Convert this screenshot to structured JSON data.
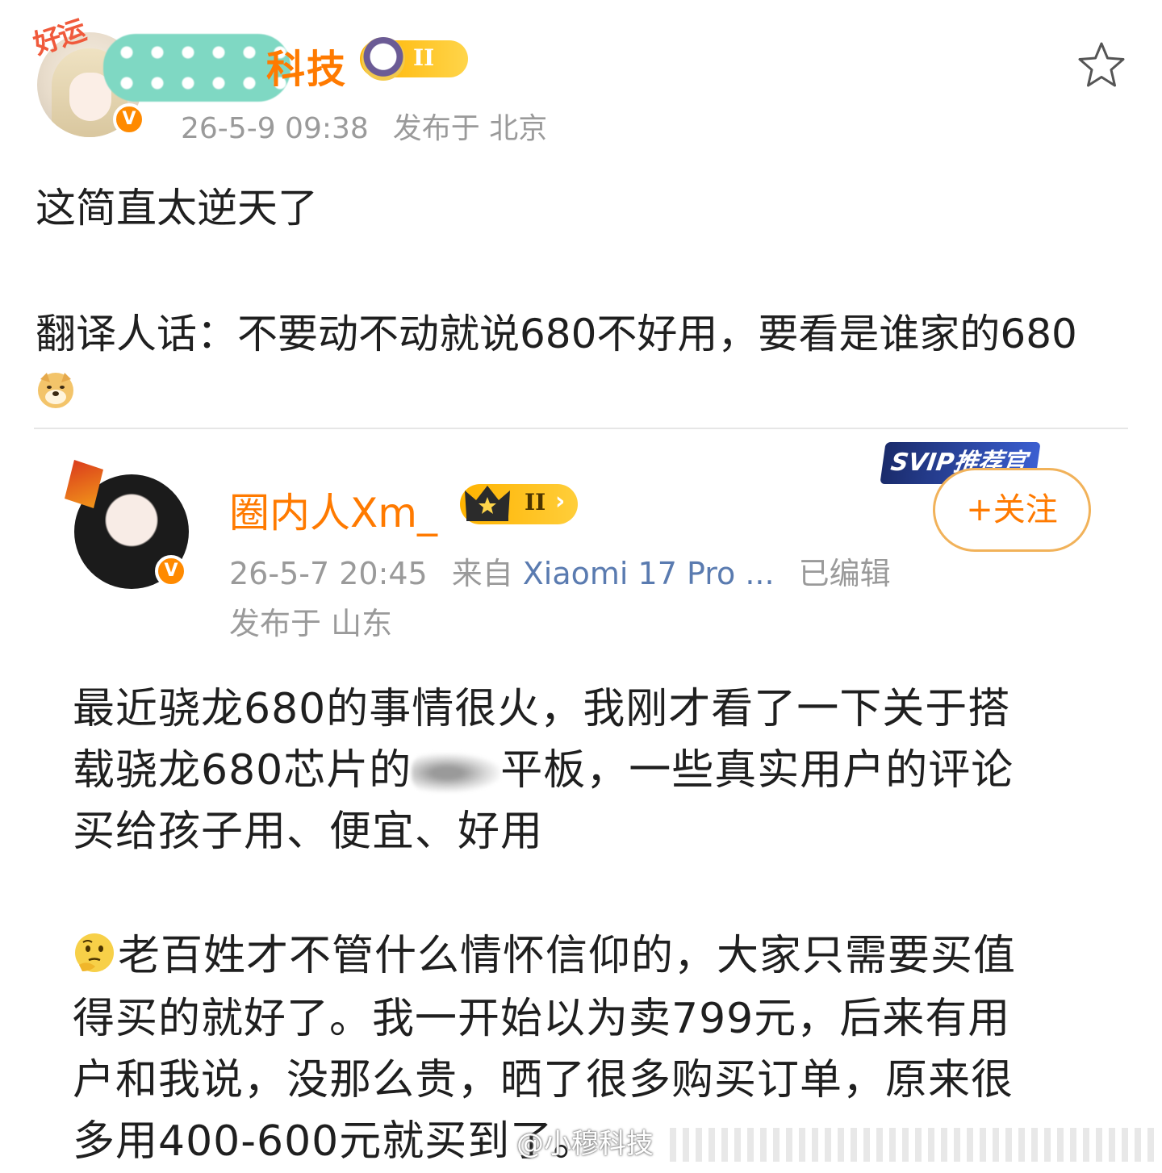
{
  "post": {
    "author_name_visible": "科技",
    "avatar_badge": "好运",
    "level_badge": "II",
    "verified_icon": "v-badge-icon",
    "timestamp": "26-5-9 09:38",
    "location": "发布于 北京",
    "favorite_icon": "star-outline-icon",
    "text_line1": "这简直太逆天了",
    "text_line2": "翻译人话：不要动不动就说680不好用，要看是谁家的680",
    "emoji": "doge-icon"
  },
  "quoted": {
    "author_name": "圈内人Xm_",
    "level_badge": "II",
    "svip_tag": "SVIP推荐官",
    "follow_label": "+关注",
    "timestamp": "26-5-7 20:45",
    "source": "来自",
    "device": "Xiaomi 17 Pro ...",
    "edited": "已编辑",
    "location": "发布于 山东",
    "para1": {
      "line1": "最近骁龙680的事情很火，我刚才看了一下关于搭",
      "line2a": "载骁龙680芯片的",
      "line2b": "平板，一些真实用户的评论",
      "line3": "买给孩子用、便宜、好用"
    },
    "para2": {
      "emoji": "thinking-face-icon",
      "line1": "老百姓才不管什么情怀信仰的，大家只需要买值",
      "line2": "得买的就好了。我一开始以为卖799元，后来有用",
      "line3": "户和我说，没那么贵，晒了很多购买订单，原来很",
      "line4": "多用400-600元就买到了。"
    }
  },
  "watermark": "@小穆科技",
  "colors": {
    "accent": "#ff7a00",
    "text": "#1f1f1f",
    "meta": "#9a9a9a",
    "device_link": "#5a7bb0",
    "follow_border": "#f1b25a"
  }
}
